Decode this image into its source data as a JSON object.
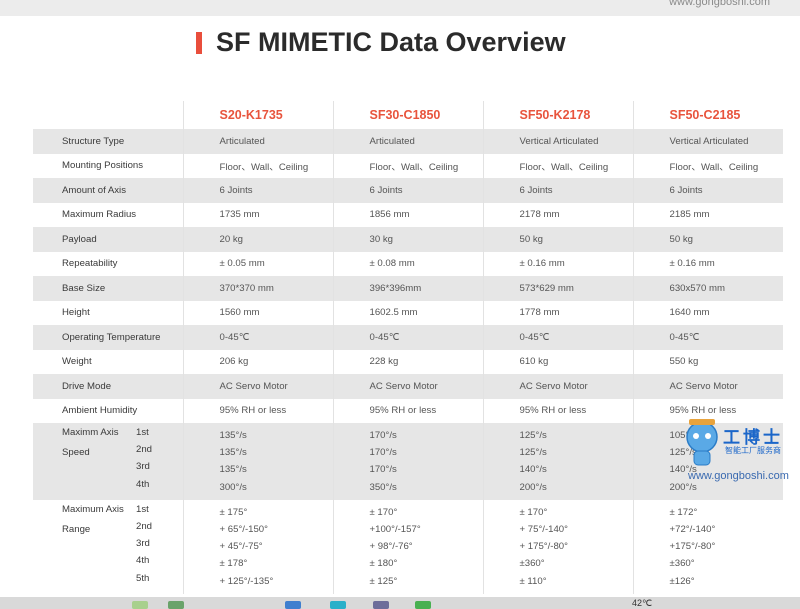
{
  "browser": {
    "url_text": "www.gongboshi.com"
  },
  "title": "SF MIMETIC Data Overview",
  "models": [
    "S20-K1735",
    "SF30-C1850",
    "SF50-K2178",
    "SF50-C2185"
  ],
  "rows": [
    {
      "label": "Structure Type",
      "values": [
        "Articulated",
        "Articulated",
        "Vertical Articulated",
        "Vertical Articulated"
      ]
    },
    {
      "label": "Mounting Positions",
      "values": [
        "Floor、Wall、Ceiling",
        "Floor、Wall、Ceiling",
        "Floor、Wall、Ceiling",
        "Floor、Wall、Ceiling"
      ]
    },
    {
      "label": "Amount of Axis",
      "values": [
        "6 Joints",
        "6 Joints",
        "6 Joints",
        "6 Joints"
      ]
    },
    {
      "label": "Maximum Radius",
      "values": [
        "1735 mm",
        "1856 mm",
        "2178 mm",
        "2185 mm"
      ]
    },
    {
      "label": "Payload",
      "values": [
        "20 kg",
        "30 kg",
        "50 kg",
        "50 kg"
      ]
    },
    {
      "label": "Repeatability",
      "values": [
        "± 0.05 mm",
        "± 0.08 mm",
        "± 0.16 mm",
        "± 0.16 mm"
      ]
    },
    {
      "label": "Base Size",
      "values": [
        "370*370 mm",
        "396*396mm",
        "573*629 mm",
        "630x570 mm"
      ]
    },
    {
      "label": "Height",
      "values": [
        "1560 mm",
        "1602.5 mm",
        "1778 mm",
        "1640 mm"
      ]
    },
    {
      "label": "Operating Temperature",
      "values": [
        "0-45℃",
        "0-45℃",
        "0-45℃",
        "0-45℃"
      ]
    },
    {
      "label": "Weight",
      "values": [
        "206 kg",
        "228 kg",
        "610 kg",
        "550 kg"
      ]
    },
    {
      "label": "Drive Mode",
      "values": [
        "AC Servo Motor",
        "AC Servo Motor",
        "AC Servo Motor",
        "AC Servo Motor"
      ]
    },
    {
      "label": "Ambient Humidity",
      "values": [
        "95% RH or less",
        "95% RH or less",
        "95% RH or less",
        "95% RH or less"
      ]
    }
  ],
  "speed": {
    "label_line1": "Maximm Axis",
    "label_line2": "Speed",
    "axes": [
      "1st",
      "2nd",
      "3rd",
      "4th"
    ],
    "values": [
      [
        "135°/s",
        "135°/s",
        "135°/s",
        "300°/s"
      ],
      [
        "170°/s",
        "170°/s",
        "170°/s",
        "350°/s"
      ],
      [
        "125°/s",
        "125°/s",
        "140°/s",
        "200°/s"
      ],
      [
        "105°/s",
        "125°/s",
        "140°/s",
        "200°/s"
      ]
    ]
  },
  "range": {
    "label_line1": "Maximum Axis",
    "label_line2": "Range",
    "axes": [
      "1st",
      "2nd",
      "3rd",
      "4th",
      "5th"
    ],
    "values": [
      [
        "± 175°",
        "+ 65°/-150°",
        "+ 45°/-75°",
        "± 178°",
        "+ 125°/-135°"
      ],
      [
        "± 170°",
        "+100°/-157°",
        "+ 98°/-76°",
        "± 180°",
        "± 125°"
      ],
      [
        "± 170°",
        "+ 75°/-140°",
        "+ 175°/-80°",
        "±360°",
        "± 110°"
      ],
      [
        "± 172°",
        "+72°/-140°",
        "+175°/-80°",
        "±360°",
        "±126°"
      ]
    ]
  },
  "watermark": {
    "brand": "工博士",
    "tagline": "智能工厂服务商",
    "url": "www.gongboshi.com"
  },
  "taskbar": {
    "temperature": "42℃"
  },
  "colors": {
    "accent": "#e94e3c",
    "shade": "#e6e6e6"
  }
}
